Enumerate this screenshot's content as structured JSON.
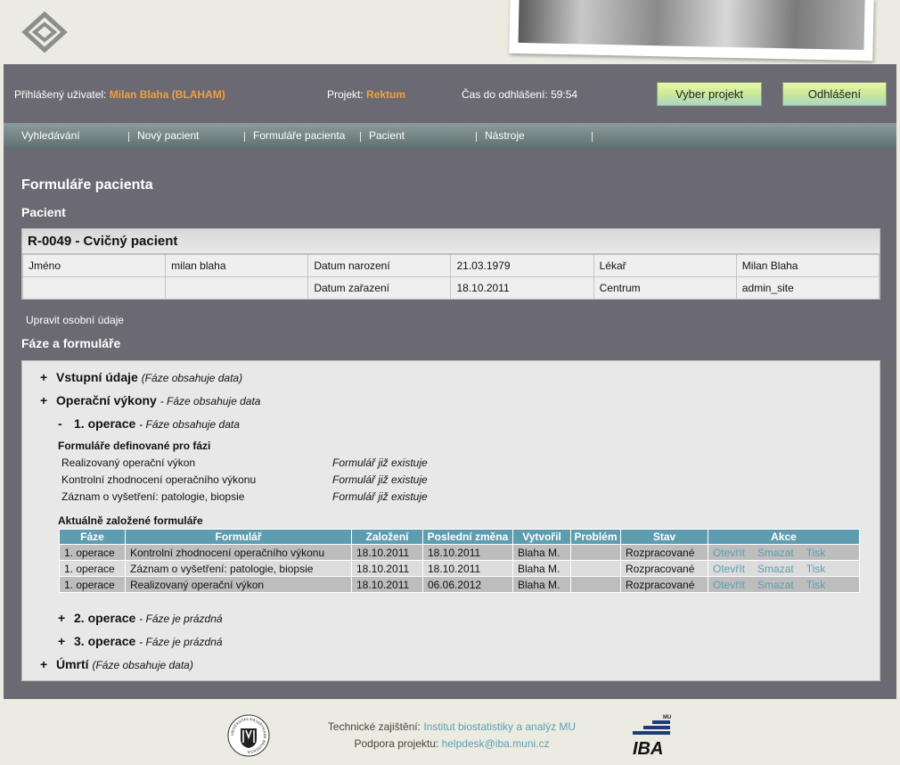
{
  "header": {
    "logged_user_label": "Přihlášený uživatel:",
    "logged_user_value": "Milan Blaha (BLAHAM)",
    "project_label": "Projekt:",
    "project_value": "Rektum",
    "timeout_label": "Čas do odhlášení:",
    "timeout_value": "59:54",
    "select_project_button": "Vyber projekt",
    "logout_button": "Odhlášení"
  },
  "nav": [
    "Vyhledávání",
    "Nový pacient",
    "Formuláře pacienta",
    "Pacient",
    "Nástroje"
  ],
  "page_title": "Formuláře pacienta",
  "patient_section_title": "Pacient",
  "patient": {
    "title": "R-0049 - Cvičný pacient",
    "rows": [
      [
        "Jméno",
        "milan blaha",
        "Datum narození",
        "21.03.1979",
        "Lékař",
        "Milan Blaha"
      ],
      [
        "",
        "",
        "Datum zařazení",
        "18.10.2011",
        "Centrum",
        "admin_site"
      ]
    ]
  },
  "edit_personal_link": "Upravit osobní údaje",
  "phases_section_title": "Fáze a formuláře",
  "phases": {
    "p1": {
      "toggle": "+",
      "name": "Vstupní údaje",
      "note": "(Fáze obsahuje data)"
    },
    "p2": {
      "toggle": "+",
      "name": "Operační výkony",
      "note": "- Fáze obsahuje data"
    },
    "p2a": {
      "toggle": "-",
      "name": "1. operace",
      "note": "- Fáze obsahuje data"
    },
    "p2b": {
      "toggle": "+",
      "name": "2. operace",
      "note": "- Fáze je prázdná"
    },
    "p2c": {
      "toggle": "+",
      "name": "3. operace",
      "note": "- Fáze je prázdná"
    },
    "p3": {
      "toggle": "+",
      "name": "Úmrtí",
      "note": "(Fáze obsahuje data)"
    }
  },
  "defined_forms_title": "Formuláře definované pro fázi",
  "defined_forms": [
    {
      "name": "Realizovaný operační výkon",
      "state": "Formulář již existuje"
    },
    {
      "name": "Kontrolní zhodnocení operačního výkonu",
      "state": "Formulář již existuje"
    },
    {
      "name": "Záznam o vyšetření: patologie, biopsie",
      "state": "Formulář již existuje"
    }
  ],
  "current_forms_title": "Aktuálně založené formuláře",
  "forms_table": {
    "headers": [
      "Fáze",
      "Formulář",
      "Založení",
      "Poslední změna",
      "Vytvořil",
      "Problém",
      "Stav",
      "Akce"
    ],
    "rows": [
      [
        "1. operace",
        "Kontrolní zhodnocení operačního výkonu",
        "18.10.2011",
        "18.10.2011",
        "Blaha M.",
        "",
        "Rozpracované"
      ],
      [
        "1. operace",
        "Záznam o vyšetření: patologie, biopsie",
        "18.10.2011",
        "18.10.2011",
        "Blaha M.",
        "",
        "Rozpracované"
      ],
      [
        "1. operace",
        "Realizovaný operační výkon",
        "18.10.2011",
        "06.06.2012",
        "Blaha M.",
        "",
        "Rozpracované"
      ]
    ],
    "actions": [
      "Otevřít",
      "Smazat",
      "Tisk"
    ]
  },
  "footer": {
    "tech_label": "Technické zajištění:",
    "tech_link": "Institut biostatistiky a analýz MU",
    "support_label": "Podpora projektu:",
    "support_link": "helpdesk@iba.muni.cz",
    "mu_seal_text": "UNIVERSITAS MASARYKIANA BRUNENSIS",
    "iba_logo_text": "IBA",
    "iba_logo_small": "MU"
  },
  "colors": {
    "accent_orange": "#f0a040",
    "table_header": "#5e9cb0",
    "link_blue": "#5b9fb2",
    "main_bg": "#6b6a72"
  }
}
